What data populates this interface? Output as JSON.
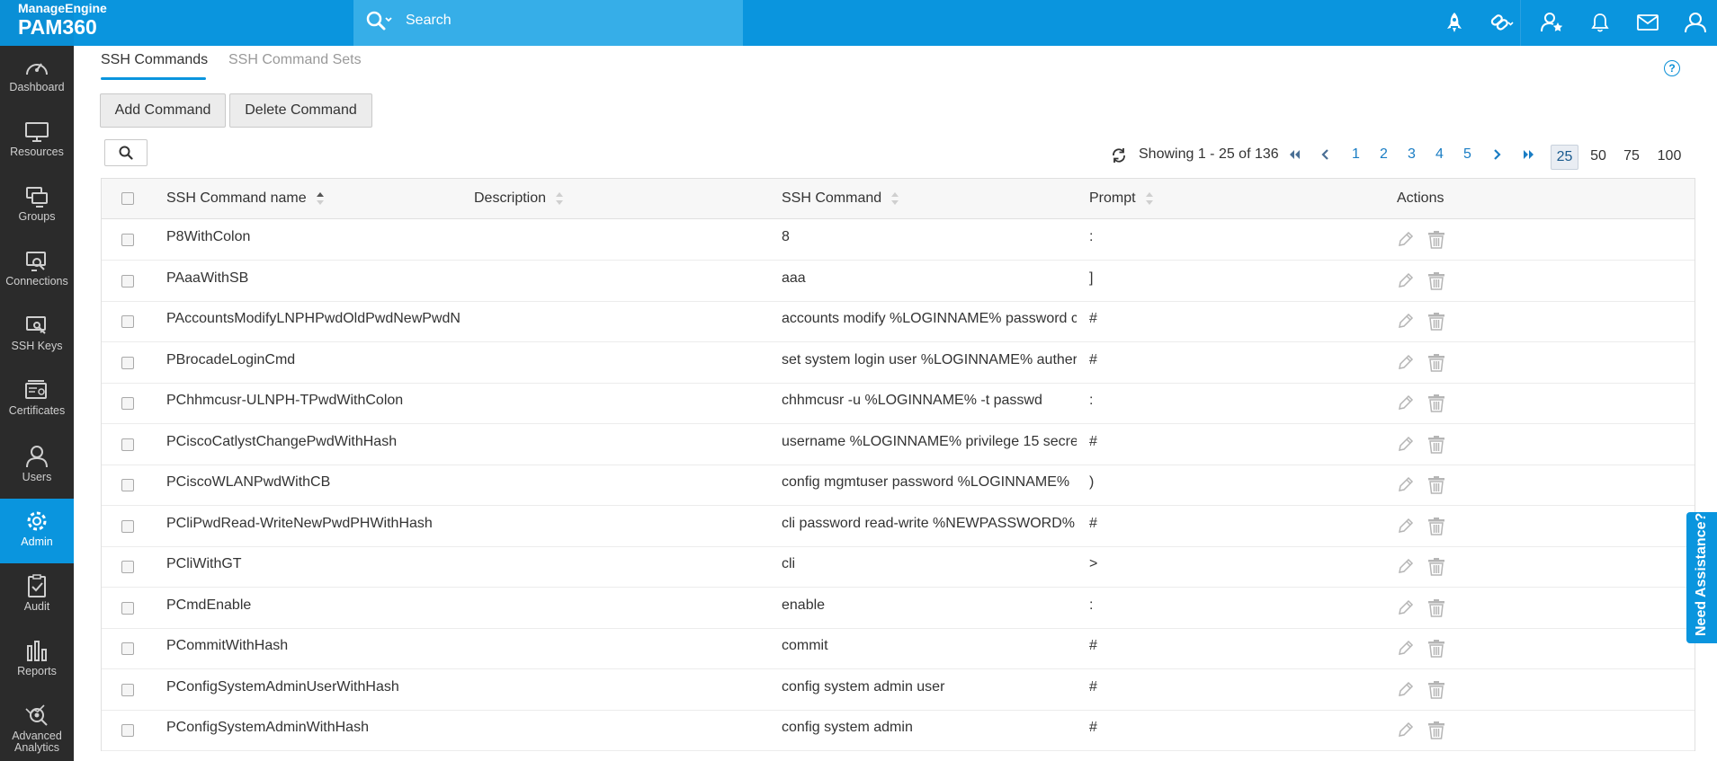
{
  "app": {
    "brand_small": "ManageEngine",
    "brand_large": "PAM360"
  },
  "search": {
    "placeholder": "Search"
  },
  "sidebar": {
    "items": [
      {
        "label": "Dashboard",
        "icon": "dashboard-icon"
      },
      {
        "label": "Resources",
        "icon": "monitor-icon"
      },
      {
        "label": "Groups",
        "icon": "groups-icon"
      },
      {
        "label": "Connections",
        "icon": "connections-icon"
      },
      {
        "label": "SSH Keys",
        "icon": "ssh-key-icon"
      },
      {
        "label": "Certificates",
        "icon": "certificate-icon"
      },
      {
        "label": "Users",
        "icon": "user-icon"
      },
      {
        "label": "Admin",
        "icon": "gear-icon"
      },
      {
        "label": "Audit",
        "icon": "clipboard-check-icon"
      },
      {
        "label": "Reports",
        "icon": "bar-chart-icon"
      },
      {
        "label": "Advanced Analytics",
        "icon": "analytics-icon"
      }
    ],
    "active": "Admin"
  },
  "tabs": [
    {
      "label": "SSH Commands",
      "active": true
    },
    {
      "label": "SSH Command Sets",
      "active": false
    }
  ],
  "toolbar": {
    "add_label": "Add Command",
    "delete_label": "Delete Command"
  },
  "pagination": {
    "showing": "Showing 1 - 25 of 136",
    "pages": [
      "1",
      "2",
      "3",
      "4",
      "5"
    ],
    "sizes": [
      "25",
      "50",
      "75",
      "100"
    ],
    "selected_size": "25"
  },
  "table": {
    "headers": {
      "name": "SSH Command name",
      "description": "Description",
      "command": "SSH Command",
      "prompt": "Prompt",
      "actions": "Actions"
    },
    "rows": [
      {
        "name": "P8WithColon",
        "description": "",
        "command": "8",
        "prompt": ":"
      },
      {
        "name": "PAaaWithSB",
        "description": "",
        "command": "aaa",
        "prompt": "]"
      },
      {
        "name": "PAccountsModifyLNPHPwdOldPwdNewPwdN",
        "description": "",
        "command": "accounts modify %LOGINNAME% password c",
        "prompt": "#"
      },
      {
        "name": "PBrocadeLoginCmd",
        "description": "",
        "command": "set system login user %LOGINNAME% auther",
        "prompt": "#"
      },
      {
        "name": "PChhmcusr-ULNPH-TPwdWithColon",
        "description": "",
        "command": "chhmcusr -u %LOGINNAME% -t passwd",
        "prompt": ":"
      },
      {
        "name": "PCiscoCatlystChangePwdWithHash",
        "description": "",
        "command": "username %LOGINNAME% privilege 15 secre",
        "prompt": "#"
      },
      {
        "name": "PCiscoWLANPwdWithCB",
        "description": "",
        "command": "config mgmtuser password %LOGINNAME%",
        "prompt": ")"
      },
      {
        "name": "PCliPwdRead-WriteNewPwdPHWithHash",
        "description": "",
        "command": "cli password read-write %NEWPASSWORD%",
        "prompt": "#"
      },
      {
        "name": "PCliWithGT",
        "description": "",
        "command": "cli",
        "prompt": ">"
      },
      {
        "name": "PCmdEnable",
        "description": "",
        "command": "enable",
        "prompt": ":"
      },
      {
        "name": "PCommitWithHash",
        "description": "",
        "command": "commit",
        "prompt": "#"
      },
      {
        "name": "PConfigSystemAdminUserWithHash",
        "description": "",
        "command": "config system admin user",
        "prompt": "#"
      },
      {
        "name": "PConfigSystemAdminWithHash",
        "description": "",
        "command": "config system admin",
        "prompt": "#"
      }
    ]
  },
  "assistance": {
    "label": "Need Assistance?"
  },
  "colors": {
    "accent": "#0a95de",
    "sidebar": "#2b2b2b",
    "link": "#1a7dc4"
  }
}
